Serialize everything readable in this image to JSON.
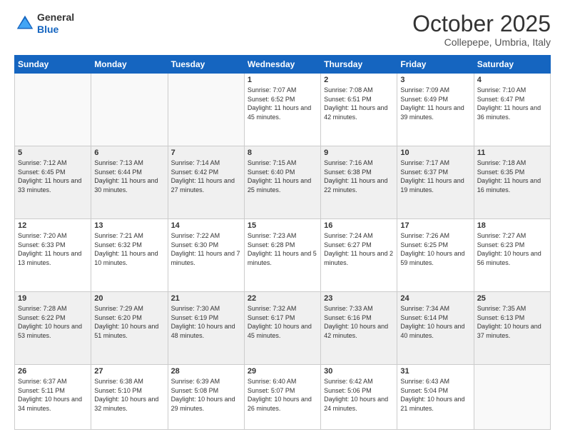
{
  "header": {
    "logo_general": "General",
    "logo_blue": "Blue",
    "month": "October 2025",
    "location": "Collepepe, Umbria, Italy"
  },
  "weekdays": [
    "Sunday",
    "Monday",
    "Tuesday",
    "Wednesday",
    "Thursday",
    "Friday",
    "Saturday"
  ],
  "weeks": [
    [
      {
        "day": "",
        "info": ""
      },
      {
        "day": "",
        "info": ""
      },
      {
        "day": "",
        "info": ""
      },
      {
        "day": "1",
        "info": "Sunrise: 7:07 AM\nSunset: 6:52 PM\nDaylight: 11 hours and 45 minutes."
      },
      {
        "day": "2",
        "info": "Sunrise: 7:08 AM\nSunset: 6:51 PM\nDaylight: 11 hours and 42 minutes."
      },
      {
        "day": "3",
        "info": "Sunrise: 7:09 AM\nSunset: 6:49 PM\nDaylight: 11 hours and 39 minutes."
      },
      {
        "day": "4",
        "info": "Sunrise: 7:10 AM\nSunset: 6:47 PM\nDaylight: 11 hours and 36 minutes."
      }
    ],
    [
      {
        "day": "5",
        "info": "Sunrise: 7:12 AM\nSunset: 6:45 PM\nDaylight: 11 hours and 33 minutes."
      },
      {
        "day": "6",
        "info": "Sunrise: 7:13 AM\nSunset: 6:44 PM\nDaylight: 11 hours and 30 minutes."
      },
      {
        "day": "7",
        "info": "Sunrise: 7:14 AM\nSunset: 6:42 PM\nDaylight: 11 hours and 27 minutes."
      },
      {
        "day": "8",
        "info": "Sunrise: 7:15 AM\nSunset: 6:40 PM\nDaylight: 11 hours and 25 minutes."
      },
      {
        "day": "9",
        "info": "Sunrise: 7:16 AM\nSunset: 6:38 PM\nDaylight: 11 hours and 22 minutes."
      },
      {
        "day": "10",
        "info": "Sunrise: 7:17 AM\nSunset: 6:37 PM\nDaylight: 11 hours and 19 minutes."
      },
      {
        "day": "11",
        "info": "Sunrise: 7:18 AM\nSunset: 6:35 PM\nDaylight: 11 hours and 16 minutes."
      }
    ],
    [
      {
        "day": "12",
        "info": "Sunrise: 7:20 AM\nSunset: 6:33 PM\nDaylight: 11 hours and 13 minutes."
      },
      {
        "day": "13",
        "info": "Sunrise: 7:21 AM\nSunset: 6:32 PM\nDaylight: 11 hours and 10 minutes."
      },
      {
        "day": "14",
        "info": "Sunrise: 7:22 AM\nSunset: 6:30 PM\nDaylight: 11 hours and 7 minutes."
      },
      {
        "day": "15",
        "info": "Sunrise: 7:23 AM\nSunset: 6:28 PM\nDaylight: 11 hours and 5 minutes."
      },
      {
        "day": "16",
        "info": "Sunrise: 7:24 AM\nSunset: 6:27 PM\nDaylight: 11 hours and 2 minutes."
      },
      {
        "day": "17",
        "info": "Sunrise: 7:26 AM\nSunset: 6:25 PM\nDaylight: 10 hours and 59 minutes."
      },
      {
        "day": "18",
        "info": "Sunrise: 7:27 AM\nSunset: 6:23 PM\nDaylight: 10 hours and 56 minutes."
      }
    ],
    [
      {
        "day": "19",
        "info": "Sunrise: 7:28 AM\nSunset: 6:22 PM\nDaylight: 10 hours and 53 minutes."
      },
      {
        "day": "20",
        "info": "Sunrise: 7:29 AM\nSunset: 6:20 PM\nDaylight: 10 hours and 51 minutes."
      },
      {
        "day": "21",
        "info": "Sunrise: 7:30 AM\nSunset: 6:19 PM\nDaylight: 10 hours and 48 minutes."
      },
      {
        "day": "22",
        "info": "Sunrise: 7:32 AM\nSunset: 6:17 PM\nDaylight: 10 hours and 45 minutes."
      },
      {
        "day": "23",
        "info": "Sunrise: 7:33 AM\nSunset: 6:16 PM\nDaylight: 10 hours and 42 minutes."
      },
      {
        "day": "24",
        "info": "Sunrise: 7:34 AM\nSunset: 6:14 PM\nDaylight: 10 hours and 40 minutes."
      },
      {
        "day": "25",
        "info": "Sunrise: 7:35 AM\nSunset: 6:13 PM\nDaylight: 10 hours and 37 minutes."
      }
    ],
    [
      {
        "day": "26",
        "info": "Sunrise: 6:37 AM\nSunset: 5:11 PM\nDaylight: 10 hours and 34 minutes."
      },
      {
        "day": "27",
        "info": "Sunrise: 6:38 AM\nSunset: 5:10 PM\nDaylight: 10 hours and 32 minutes."
      },
      {
        "day": "28",
        "info": "Sunrise: 6:39 AM\nSunset: 5:08 PM\nDaylight: 10 hours and 29 minutes."
      },
      {
        "day": "29",
        "info": "Sunrise: 6:40 AM\nSunset: 5:07 PM\nDaylight: 10 hours and 26 minutes."
      },
      {
        "day": "30",
        "info": "Sunrise: 6:42 AM\nSunset: 5:06 PM\nDaylight: 10 hours and 24 minutes."
      },
      {
        "day": "31",
        "info": "Sunrise: 6:43 AM\nSunset: 5:04 PM\nDaylight: 10 hours and 21 minutes."
      },
      {
        "day": "",
        "info": ""
      }
    ]
  ]
}
